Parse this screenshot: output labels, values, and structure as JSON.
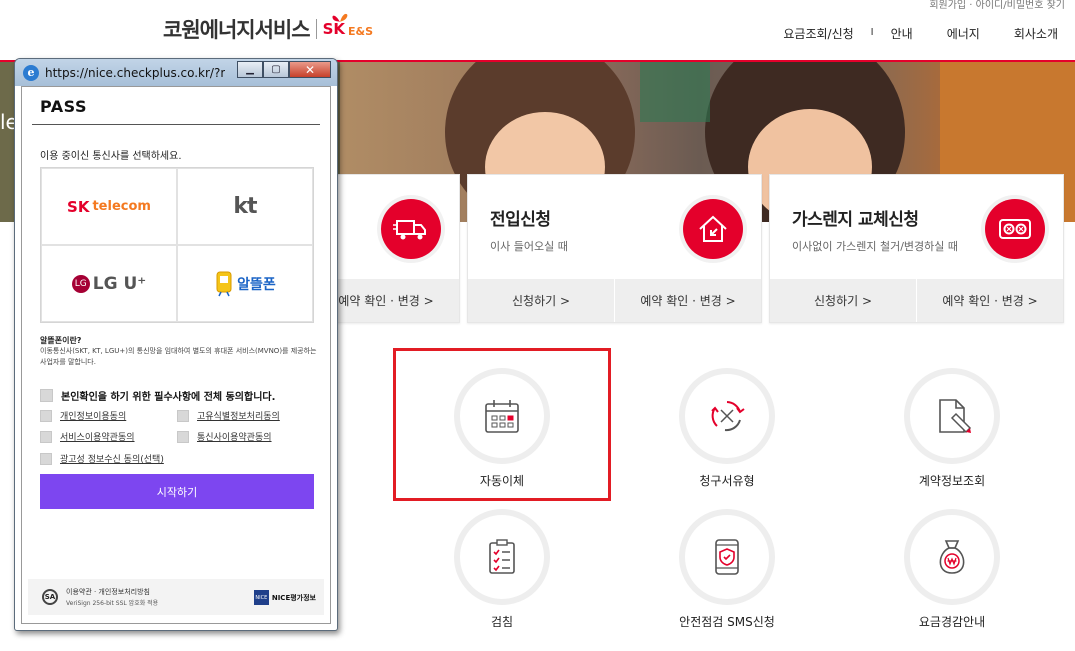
{
  "header": {
    "logo_text": "코원에너지서비스",
    "logo_sk": "SK",
    "logo_es": "E&S",
    "util_text": "회원가입 · 아이디/비밀번호 찾기",
    "nav": [
      {
        "label": "요금조회/신청"
      },
      {
        "label": "안내"
      },
      {
        "label": "에너지"
      },
      {
        "label": "회사소개"
      }
    ],
    "nav_separator": "I"
  },
  "hero": {
    "left_text": "le"
  },
  "cards": [
    {
      "title": "",
      "desc": "",
      "icon": "truck-icon",
      "buttons": [
        {
          "label": ""
        },
        {
          "label": "예약 확인 · 변경 >"
        }
      ]
    },
    {
      "title": "전입신청",
      "desc": "이사 들어오실 때",
      "icon": "house-arrow-icon",
      "buttons": [
        {
          "label": "신청하기 >"
        },
        {
          "label": "예약 확인 · 변경 >"
        }
      ]
    },
    {
      "title": "가스렌지 교체신청",
      "desc": "이사없이 가스렌지 철거/변경하실 때",
      "icon": "gas-range-icon",
      "buttons": [
        {
          "label": "신청하기 >"
        },
        {
          "label": "예약 확인 · 변경 >"
        }
      ]
    }
  ],
  "quick_menu": [
    {
      "label": "자동이체",
      "icon": "calendar-icon"
    },
    {
      "label": "청구서유형",
      "icon": "refresh-cycle-icon"
    },
    {
      "label": "계약정보조회",
      "icon": "document-pen-icon"
    },
    {
      "label": "검침",
      "icon": "checklist-icon"
    },
    {
      "label": "안전점검 SMS신청",
      "icon": "phone-shield-icon"
    },
    {
      "label": "요금경감안내",
      "icon": "money-bag-icon"
    }
  ],
  "popup": {
    "url": "https://nice.checkplus.co.kr/?m=...",
    "window_buttons": {
      "minimize": "▁",
      "maximize": "▢",
      "close": "✕"
    },
    "brand": "PASS",
    "prompt": "이용 중이신 통신사를 선택하세요.",
    "carriers": [
      {
        "sk": "SK",
        "name": "telecom"
      },
      {
        "name": "kt"
      },
      {
        "dot": "LG",
        "name": "LG U⁺"
      },
      {
        "name": "알뜰폰"
      }
    ],
    "mvno_title": "알뜰폰이란?",
    "mvno_desc": "이동통신사(SKT, KT, LGU+)의 통신망을 임대하여 별도의 휴대폰 서비스(MVNO)를 제공하는 사업자를 말합니다.",
    "agree_all": "본인확인을 하기 위한 필수사항에 전체 동의합니다.",
    "agreements": [
      {
        "label": "개인정보이용동의"
      },
      {
        "label": "고유식별정보처리동의"
      },
      {
        "label": "서비스이용약관동의"
      },
      {
        "label": "통신사이용약관동의"
      },
      {
        "label": "광고성 정보수신 동의(선택)"
      }
    ],
    "start_button": "시작하기",
    "footer": {
      "badge": "SA",
      "line1": "이용약관 · 개인정보처리방침",
      "line2": "VeriSign 256-bit SSL 암호화 적용",
      "nice_box": "NICE",
      "nice_text": "NICE평가정보"
    }
  }
}
